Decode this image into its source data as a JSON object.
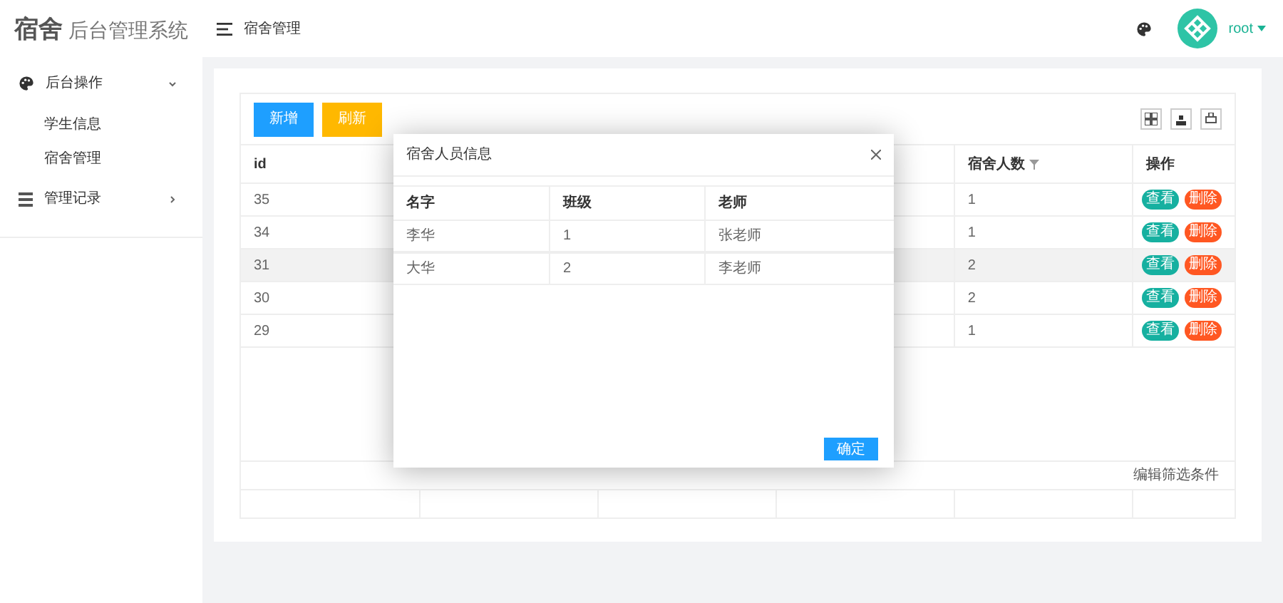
{
  "sidebar": {
    "logo": {
      "bold": "宿舍",
      "rest": "后台管理系统"
    },
    "items": [
      {
        "label": "后台操作",
        "expanded": true,
        "children": [
          {
            "label": "学生信息"
          },
          {
            "label": "宿舍管理"
          }
        ]
      },
      {
        "label": "管理记录",
        "expanded": false
      }
    ]
  },
  "header": {
    "breadcrumb": "宿舍管理",
    "user": "root"
  },
  "toolbar": {
    "buttons": [
      {
        "label": "新增",
        "kind": "primary"
      },
      {
        "label": "刷新",
        "kind": "warning"
      }
    ]
  },
  "table": {
    "columns": [
      "id",
      "",
      "",
      "",
      "宿舍人数",
      "操作"
    ],
    "rows": [
      {
        "id": "35",
        "count": "1",
        "highlighted": false,
        "actions": [
          "查看",
          "删除"
        ]
      },
      {
        "id": "34",
        "count": "1",
        "highlighted": false,
        "actions": [
          "查看",
          "删除"
        ]
      },
      {
        "id": "31",
        "count": "2",
        "highlighted": true,
        "actions": [
          "查看",
          "删除"
        ]
      },
      {
        "id": "30",
        "count": "2",
        "highlighted": false,
        "actions": [
          "查看",
          "删除"
        ]
      },
      {
        "id": "29",
        "count": "1",
        "highlighted": false,
        "actions": [
          "查看",
          "删除"
        ]
      }
    ],
    "filter_link": "编辑筛选条件"
  },
  "dialog": {
    "title": "宿舍人员信息",
    "columns": [
      "名字",
      "班级",
      "老师"
    ],
    "rows": [
      [
        "李华",
        "1",
        "张老师"
      ],
      [
        "大华",
        "2",
        "李老师"
      ]
    ],
    "button": "确定"
  }
}
